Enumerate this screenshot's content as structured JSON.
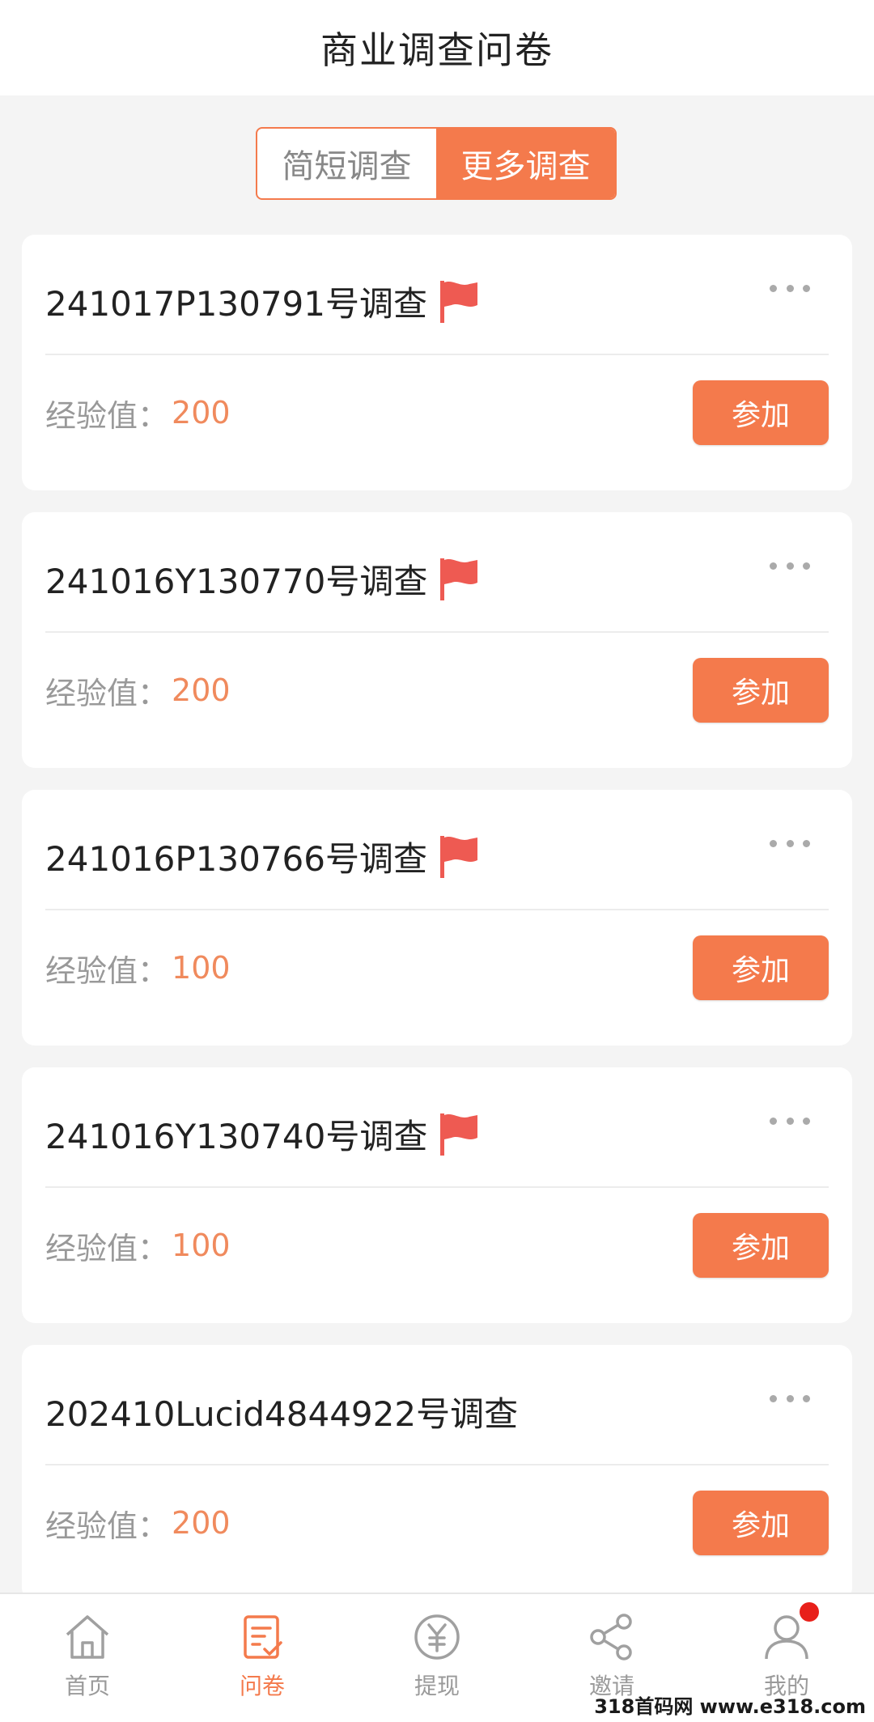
{
  "header": {
    "title": "商业调查问卷"
  },
  "segment": {
    "tabs": [
      "简短调查",
      "更多调查"
    ],
    "active": 1
  },
  "surveys": [
    {
      "title": "241017P130791号调查",
      "flag": true,
      "exp_label": "经验值：",
      "exp_value": "200",
      "button": "参加"
    },
    {
      "title": "241016Y130770号调查",
      "flag": true,
      "exp_label": "经验值：",
      "exp_value": "200",
      "button": "参加"
    },
    {
      "title": "241016P130766号调查",
      "flag": true,
      "exp_label": "经验值：",
      "exp_value": "100",
      "button": "参加"
    },
    {
      "title": "241016Y130740号调查",
      "flag": true,
      "exp_label": "经验值：",
      "exp_value": "100",
      "button": "参加"
    },
    {
      "title": "202410Lucid4844922号调查",
      "flag": false,
      "exp_label": "经验值：",
      "exp_value": "200",
      "button": "参加"
    }
  ],
  "tabbar": [
    {
      "label": "首页",
      "icon": "home-icon"
    },
    {
      "label": "问卷",
      "icon": "survey-icon",
      "active": true
    },
    {
      "label": "提现",
      "icon": "yuan-icon"
    },
    {
      "label": "邀请",
      "icon": "share-icon"
    },
    {
      "label": "我的",
      "icon": "user-icon",
      "badge": true
    }
  ],
  "watermark": "318首码网 www.e318.com",
  "colors": {
    "accent": "#f47a4c",
    "flag": "#ee5a52",
    "badge": "#e8201a"
  }
}
